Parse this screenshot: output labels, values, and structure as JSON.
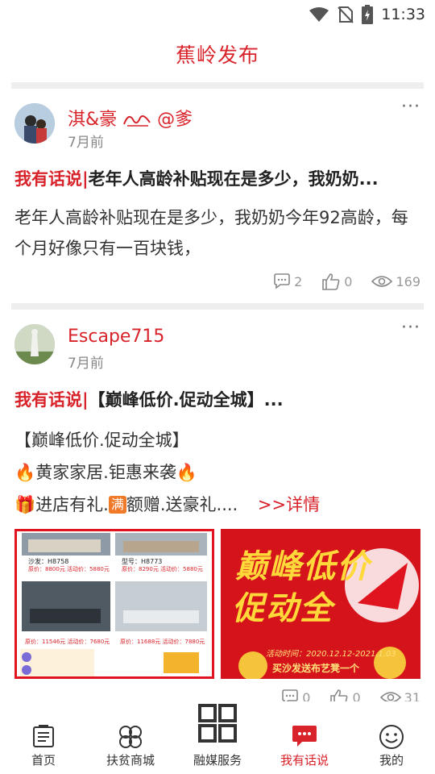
{
  "status": {
    "time": "11:33"
  },
  "header": {
    "title": "蕉岭发布"
  },
  "posts": [
    {
      "author": "淇&豪",
      "author_suffix": "@爹",
      "time": "7月前",
      "tag": "我有话说|",
      "headline": "老年人高龄补贴现在是多少，我奶奶...",
      "body": "老年人高龄补贴现在是多少，我奶奶今年92高龄，每个月好像只有一百块钱，",
      "comments": "2",
      "likes": "0",
      "views": "169"
    },
    {
      "author": "Escape715",
      "time": "7月前",
      "tag": "我有话说|",
      "headline": "【巅峰低价.促动全城】...",
      "body_line1": "【巅峰低价.促动全城】",
      "body_line2": "黄家家居.钜惠来袭",
      "body_line3a": "进店有礼.",
      "body_line3b": "额赠.送豪礼....",
      "full_badge": "满",
      "more_link": ">>详情",
      "comments": "0",
      "likes": "0",
      "views": "31",
      "image_left": {
        "row1_label": "沙发：H8758",
        "row1_price": "原价：8800元  活动价：5880元",
        "row1b_label": "型号：H8773",
        "row1b_price": "原价：8290元  活动价：5880元",
        "row2_price_a": "原价：11546元  活动价：7680元",
        "row2_price_b": "原价：11688元  活动价：7880元"
      },
      "image_right": {
        "title_line1": "巅峰低价",
        "title_line2": "促动全",
        "date": "活动时间：2020.12.12-2021.1.03",
        "slogan": "买沙发送布艺凳一个"
      }
    }
  ],
  "nav": {
    "items": [
      {
        "label": "首页"
      },
      {
        "label": "扶贫商城"
      },
      {
        "label": "融媒服务"
      },
      {
        "label": "我有话说"
      },
      {
        "label": "我的"
      }
    ],
    "active_color": "#d8232a"
  },
  "colors": {
    "accent": "#d8232a"
  }
}
